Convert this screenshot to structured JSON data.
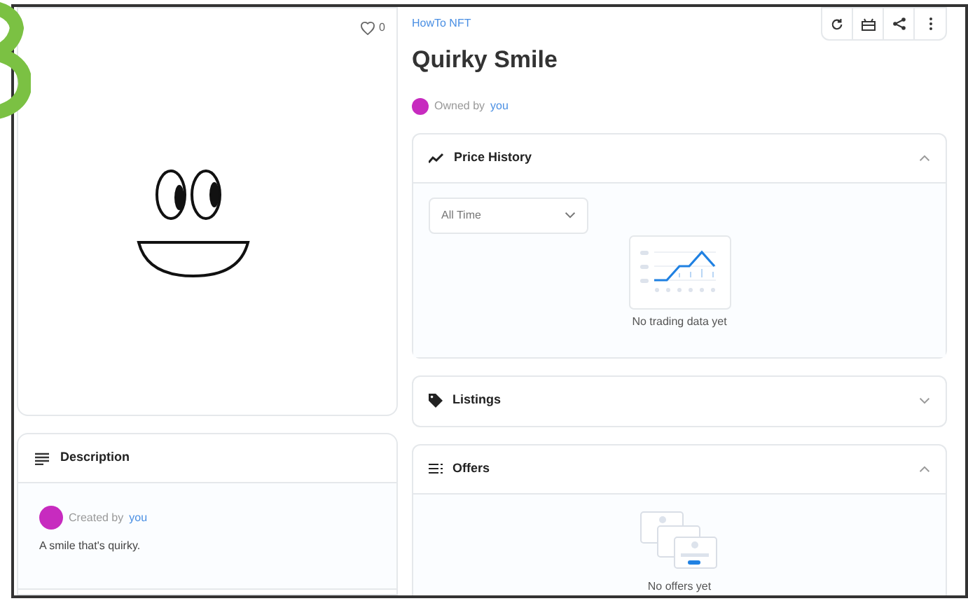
{
  "likes": {
    "count": "0"
  },
  "description": {
    "title": "Description",
    "created_by": "Created by",
    "creator": "you",
    "text": "A smile that's quirky."
  },
  "collection": "HowTo NFT",
  "title": "Quirky Smile",
  "owner": {
    "label": "Owned by",
    "name": "you"
  },
  "sections": [
    {
      "kind": "price",
      "title": "Price History",
      "expanded": true,
      "filter": "All Time",
      "empty": "No trading data yet"
    },
    {
      "kind": "listings",
      "title": "Listings",
      "expanded": false
    },
    {
      "kind": "offers",
      "title": "Offers",
      "expanded": true,
      "empty": "No offers yet"
    }
  ]
}
